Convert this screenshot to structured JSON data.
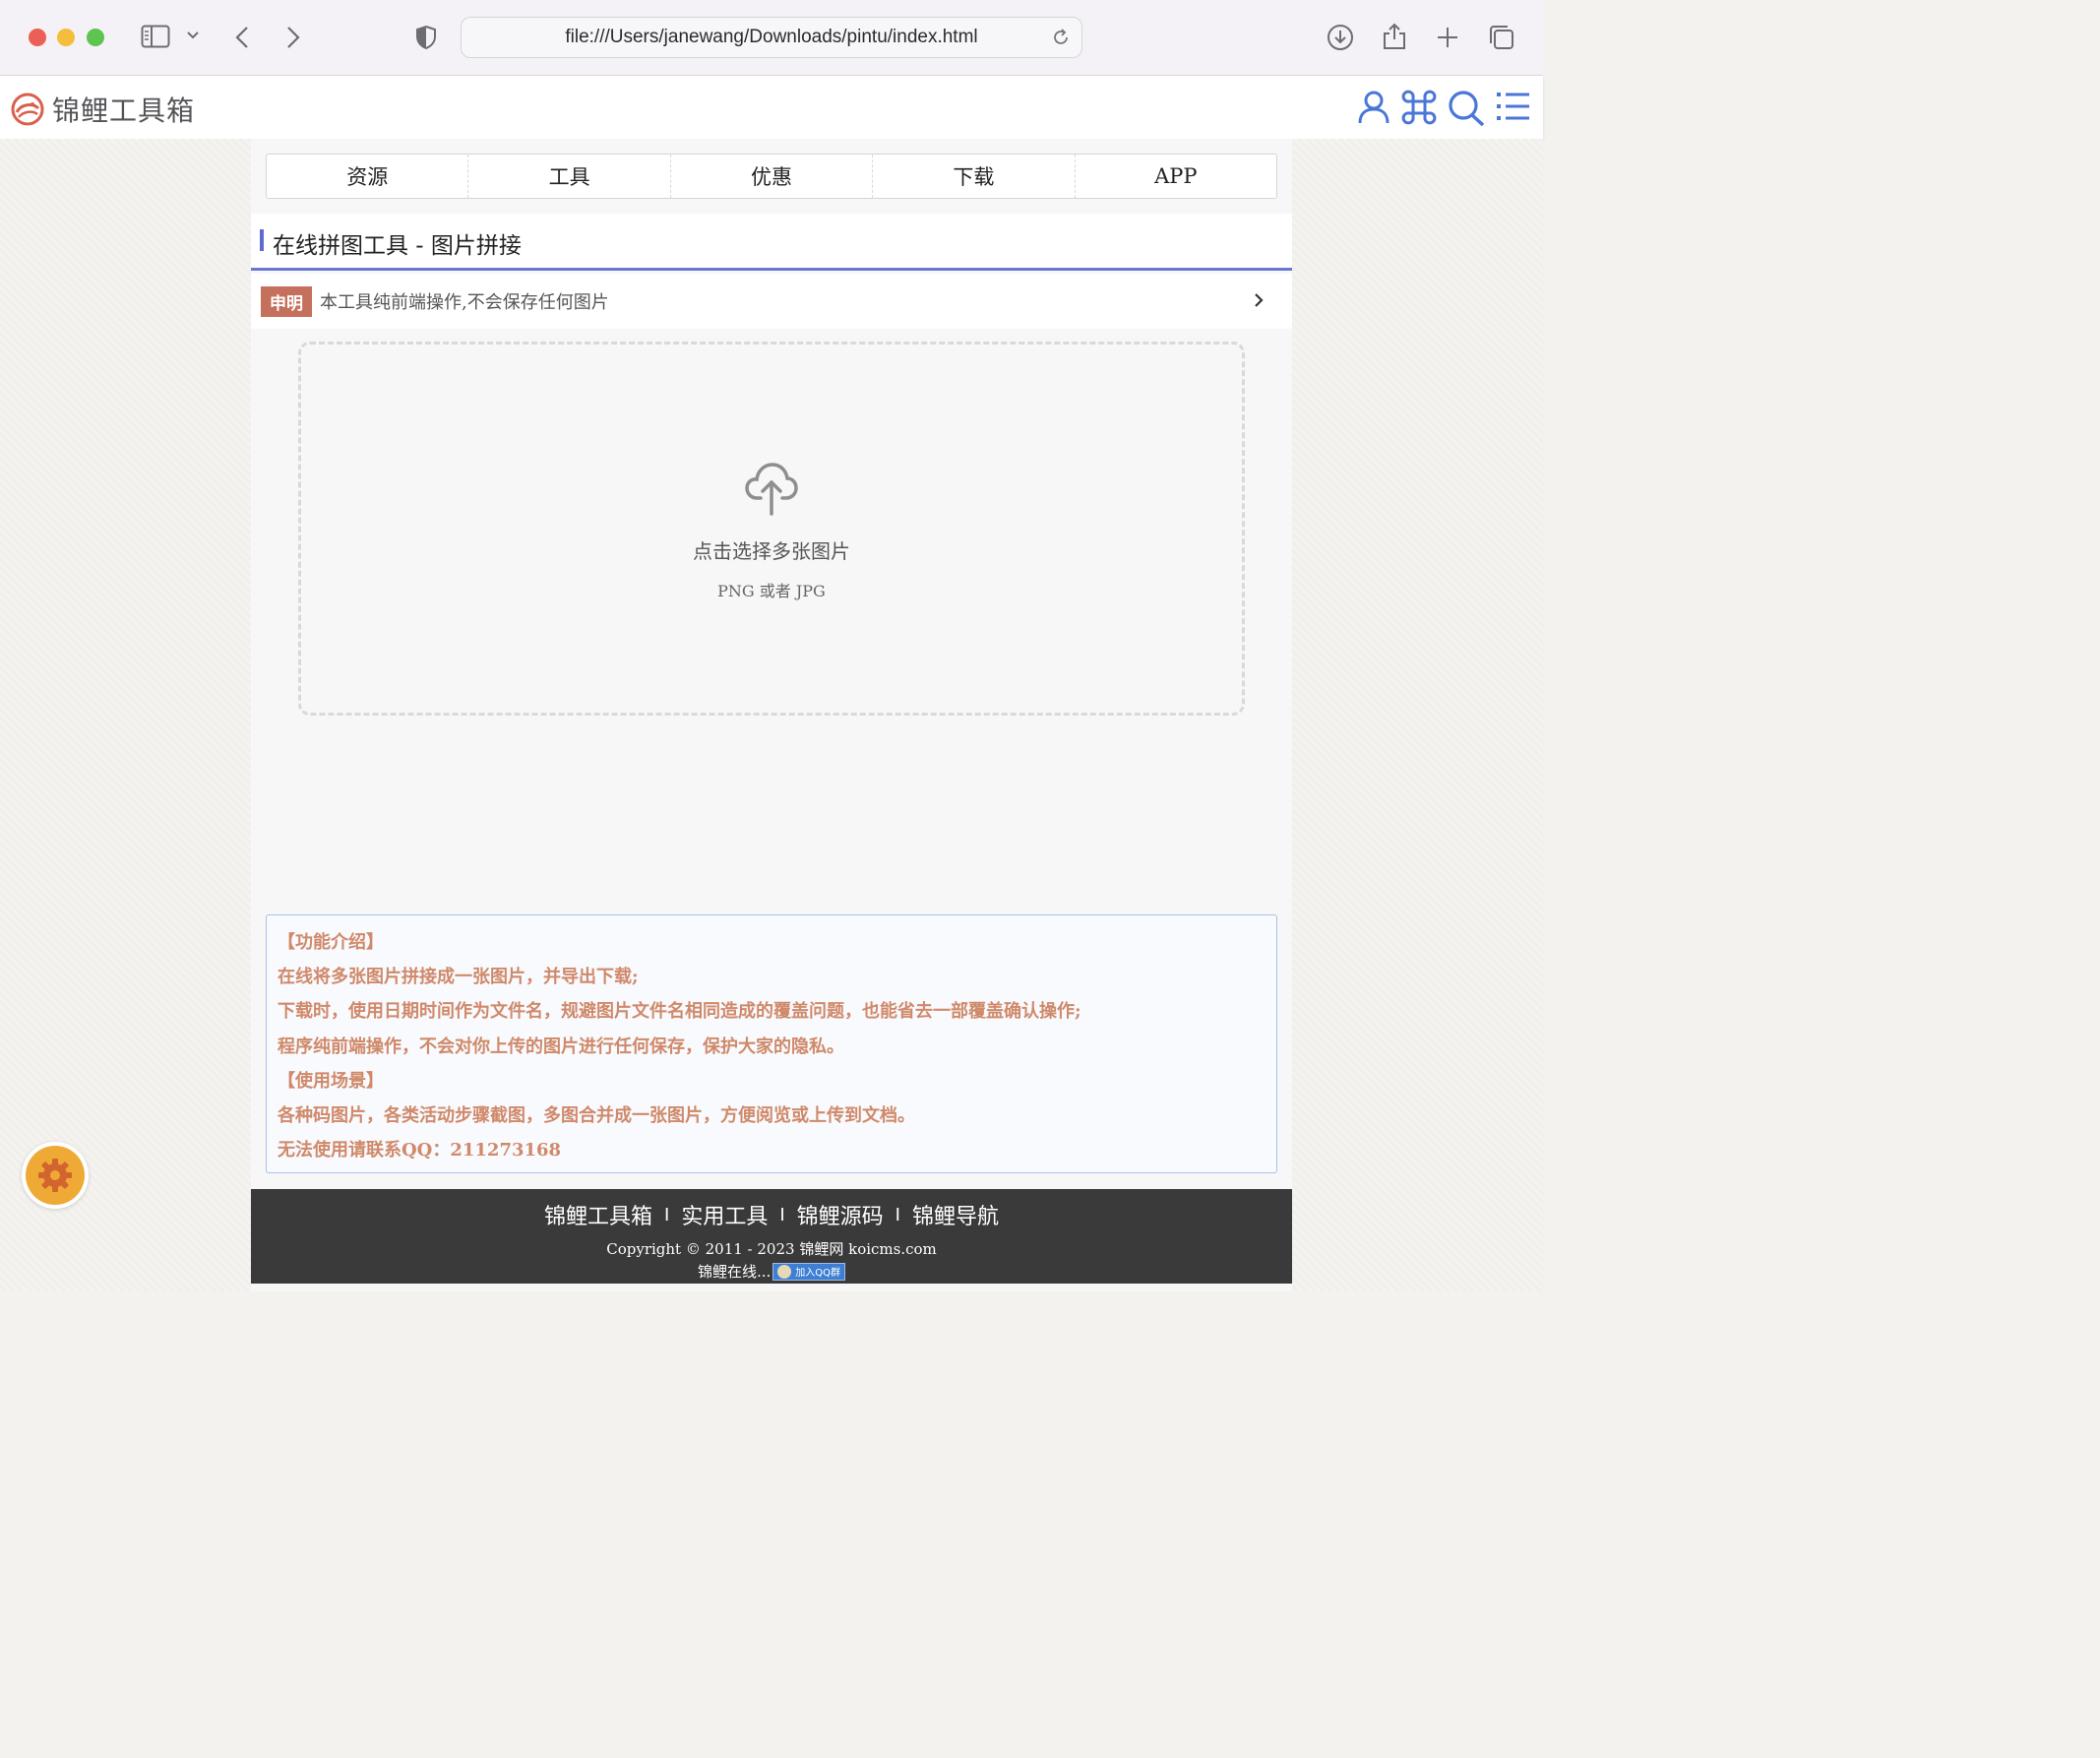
{
  "browser": {
    "url": "file:///Users/janewang/Downloads/pintu/index.html"
  },
  "site": {
    "logo_text": "锦鲤工具箱"
  },
  "nav": {
    "items": [
      "资源",
      "工具",
      "优惠",
      "下载",
      "APP"
    ]
  },
  "page": {
    "title": "在线拼图工具 - 图片拼接"
  },
  "notice": {
    "badge": "申明",
    "text": "本工具纯前端操作,不会保存任何图片"
  },
  "dropzone": {
    "title": "点击选择多张图片",
    "subtitle": "PNG 或者 JPG"
  },
  "info": {
    "lines": [
      "【功能介绍】",
      "在线将多张图片拼接成一张图片，并导出下载;",
      "下载时，使用日期时间作为文件名，规避图片文件名相同造成的覆盖问题，也能省去一部覆盖确认操作;",
      "程序纯前端操作，不会对你上传的图片进行任何保存，保护大家的隐私。",
      "【使用场景】",
      "各种码图片，各类活动步骤截图，多图合并成一张图片，方便阅览或上传到文档。",
      "无法使用请联系QQ：211273168"
    ]
  },
  "footer": {
    "links": [
      "锦鲤工具箱",
      "实用工具",
      "锦鲤源码",
      "锦鲤导航"
    ],
    "separator": "I",
    "copyright": "Copyright © 2011 - 2023 锦鲤网 koicms.com",
    "online": "锦鲤在线...",
    "qq_badge": "加入QQ群"
  },
  "colors": {
    "accent": "#5d6bd1",
    "notice_badge": "#c4705c",
    "info_text": "#d0896a",
    "header_icons": "#4a77d6",
    "gear": "#eeaa35"
  }
}
